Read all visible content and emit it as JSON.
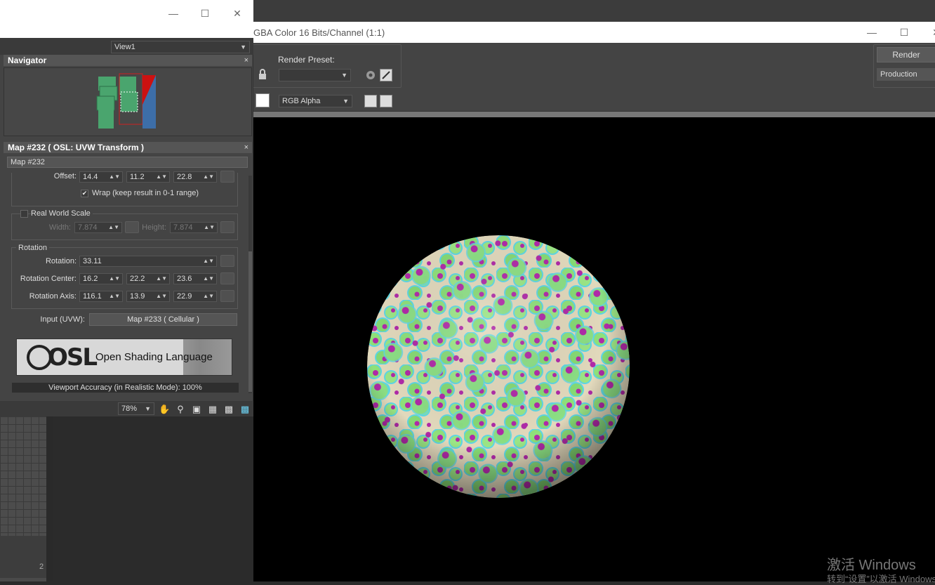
{
  "slate_editor": {
    "view_dropdown": "View1",
    "navigator": {
      "title": "Navigator",
      "close": "×"
    },
    "material_panel": {
      "title": "Map #232  ( OSL: UVW Transform )",
      "close": "×",
      "map_name": "Map #232",
      "offset": {
        "label": "Offset:",
        "x": "14.4",
        "y": "11.2",
        "z": "22.8"
      },
      "wrap_label": "Wrap (keep result in 0-1 range)",
      "wrap_checked": true,
      "real_world_scale": {
        "label": "Real World Scale",
        "width_label": "Width:",
        "width": "7.874",
        "height_label": "Height:",
        "height": "7.874"
      },
      "rotation_group": {
        "title": "Rotation",
        "rotation_label": "Rotation:",
        "rotation": "33.11",
        "center_label": "Rotation Center:",
        "center": [
          "16.2",
          "22.2",
          "23.6"
        ],
        "axis_label": "Rotation Axis:",
        "axis": [
          "116.1",
          "13.9",
          "22.9"
        ]
      },
      "input_label": "Input (UVW):",
      "input_map": "Map #233  ( Cellular )",
      "osl_text": "Open Shading Language",
      "osl_mark": "OSL",
      "viewport_accuracy": "Viewport Accuracy (in Realistic Mode): 100%"
    },
    "zoom": "78%"
  },
  "render_window": {
    "title": "GBA Color 16 Bits/Channel (1:1)",
    "render_preset_label": "Render Preset:",
    "render_button": "Render",
    "production_dropdown": "Production",
    "channel_dropdown": "RGB Alpha"
  },
  "viewport": {
    "ruler_number": "2"
  },
  "watermark": {
    "line1": "激活 Windows",
    "line2": "转到“设置”以激活 Windows"
  },
  "colors": {
    "sphere_green": "#8fe07a",
    "sphere_cream": "#e6dcc0",
    "sphere_cyan": "#5cd6e6",
    "sphere_magenta": "#b02aa8",
    "node_green": "#4aa56e"
  }
}
